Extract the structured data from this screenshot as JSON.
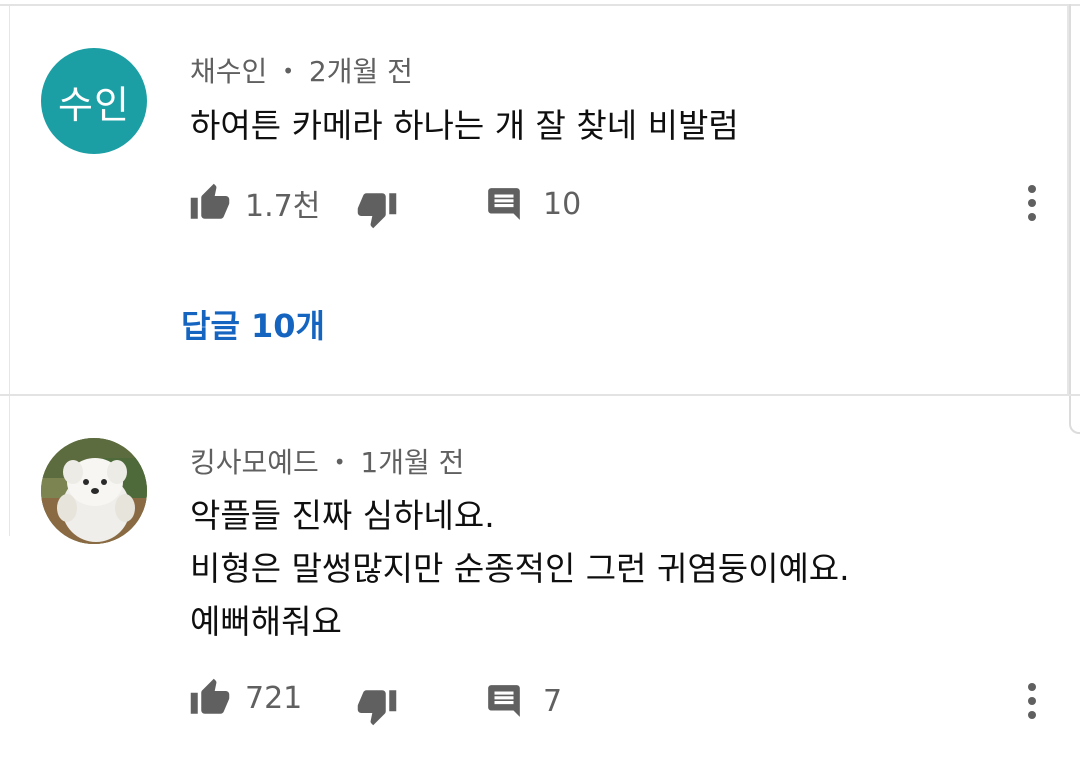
{
  "comments": [
    {
      "avatar": {
        "text": "수인",
        "color": "#1b9fa4"
      },
      "author": "채수인",
      "separator": "•",
      "time": "2개월 전",
      "lines": [
        "하여튼 카메라 하나는 개 잘 찾네 비발럼"
      ],
      "likes": "1.7천",
      "replies_count": "10",
      "replies_link": "답글 10개"
    },
    {
      "avatar": {
        "image": "white-puppy-photo"
      },
      "author": "킹사모예드",
      "separator": "•",
      "time": "1개월 전",
      "lines": [
        "악플들 진짜 심하네요.",
        "비형은 말썽많지만 순종적인 그런 귀염둥이예요.",
        "예뻐해줘요"
      ],
      "likes": "721",
      "replies_count": "7"
    }
  ],
  "icons": {
    "like": "thumbs-up-icon",
    "dislike": "thumbs-down-icon",
    "reply": "comment-icon",
    "more": "more-vertical-icon"
  },
  "colors": {
    "link": "#1565c0",
    "meta": "#606060",
    "icon": "#606060"
  }
}
